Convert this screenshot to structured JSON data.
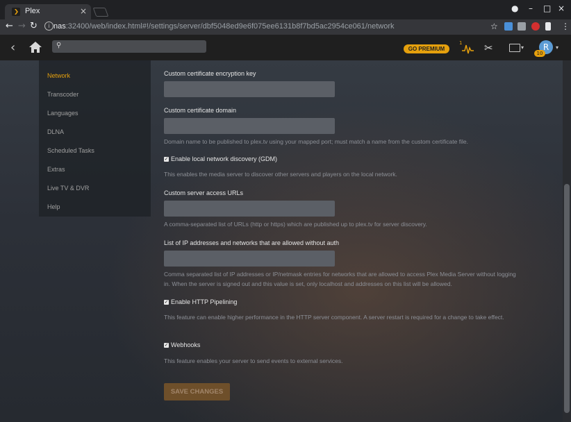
{
  "browser": {
    "tab_title": "Plex",
    "tab_close": "×",
    "window_controls": {
      "minimize": "–",
      "maximize": "□",
      "close": "×",
      "profile": "●"
    },
    "url_host": "nas",
    "url_rest": ":32400/web/index.html#!/settings/server/dbf5048ed9e6f075ee6131b8f7bd5ac2954ce061/network",
    "nav": {
      "back": "←",
      "forward": "→",
      "reload": "↻"
    },
    "star": "☆",
    "menu": "⋮",
    "extensions": [
      "#4a90d9",
      "#9aa0a6",
      "#d32f2f",
      "#e8eaed"
    ]
  },
  "plex_header": {
    "back_icon": "‹",
    "search_icon": "⚲",
    "go_premium": "GO PREMIUM",
    "activity_count": "1",
    "tools_icon": "✂",
    "cast_caret": "▾",
    "avatar_letter": "R",
    "avatar_badge": "10",
    "avatar_caret": "▾"
  },
  "sidebar": {
    "items": [
      {
        "label": "Network",
        "active": true
      },
      {
        "label": "Transcoder"
      },
      {
        "label": "Languages"
      },
      {
        "label": "DLNA"
      },
      {
        "label": "Scheduled Tasks"
      },
      {
        "label": "Extras"
      },
      {
        "label": "Live TV & DVR"
      },
      {
        "label": "Help"
      }
    ]
  },
  "form": {
    "cert_key_label": "Custom certificate encryption key",
    "cert_key_value": "",
    "cert_domain_label": "Custom certificate domain",
    "cert_domain_value": "",
    "cert_domain_help": "Domain name to be published to plex.tv using your mapped port; must match a name from the custom certificate file.",
    "gdm_label": "Enable local network discovery (GDM)",
    "gdm_help": "This enables the media server to discover other servers and players on the local network.",
    "access_urls_label": "Custom server access URLs",
    "access_urls_value": "",
    "access_urls_help": "A comma-separated list of URLs (http or https) which are published up to plex.tv for server discovery.",
    "allowed_ips_label": "List of IP addresses and networks that are allowed without auth",
    "allowed_ips_value": "",
    "allowed_ips_help": "Comma separated list of IP addresses or IP/netmask entries for networks that are allowed to access Plex Media Server without logging in. When the server is signed out and this value is set, only localhost and addresses on this list will be allowed.",
    "http_pipelining_label": "Enable HTTP Pipelining",
    "http_pipelining_help": "This feature can enable higher performance in the HTTP server component. A server restart is required for a change to take effect.",
    "webhooks_label": "Webhooks",
    "webhooks_help": "This feature enables your server to send events to external services.",
    "checkmark": "✓",
    "save_label": "SAVE CHANGES"
  },
  "colors": {
    "accent": "#e5a00d",
    "save_button": "#6e4f2a"
  }
}
